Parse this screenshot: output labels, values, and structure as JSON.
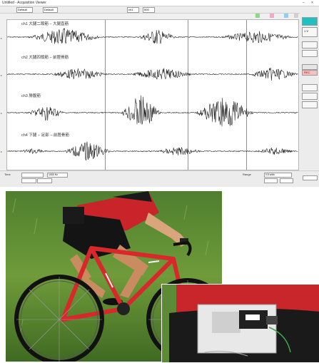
{
  "window": {
    "title": "Untitled - Acquisition Viewer",
    "minimize_glyph": "–",
    "close_glyph": "×"
  },
  "toolbar": {
    "field1": "Default",
    "field2": "Default",
    "field3": "ch1",
    "field4": "500"
  },
  "legend_tags": [
    {
      "label": "",
      "color": "#8fd68f"
    },
    {
      "label": "",
      "color": "#f4a6c8"
    },
    {
      "label": "",
      "color": "#8fd0f0"
    },
    {
      "label": "",
      "color": "#d0d0d0"
    }
  ],
  "traces": [
    {
      "label": "ch1 大腿二頭筋 − 大腿直筋",
      "channel": "CH1"
    },
    {
      "label": "ch2 大腿四頭筋 − 前脛骨筋",
      "channel": "CH2"
    },
    {
      "label": "ch3 腓腹筋",
      "channel": "CH3"
    },
    {
      "label": "ch4 下腿 − 足部 − 前脛骨筋",
      "channel": "CH4"
    }
  ],
  "side_panel": {
    "value_label": "1 V",
    "status": "REC"
  },
  "bottom": {
    "time_label": "Time",
    "rate_label": "1000 Hz",
    "range_label": "Range",
    "scale_label": "0.5 s/div"
  },
  "colors": {
    "trace": "#111111",
    "accent": "#20c0c0",
    "marker": "#e05020",
    "gridline": "#7e8ce0"
  },
  "photos": [
    {
      "name": "cyclist-on-road-bike-photo",
      "description": ""
    },
    {
      "name": "waist-worn-sensor-device-photo",
      "description": ""
    }
  ]
}
